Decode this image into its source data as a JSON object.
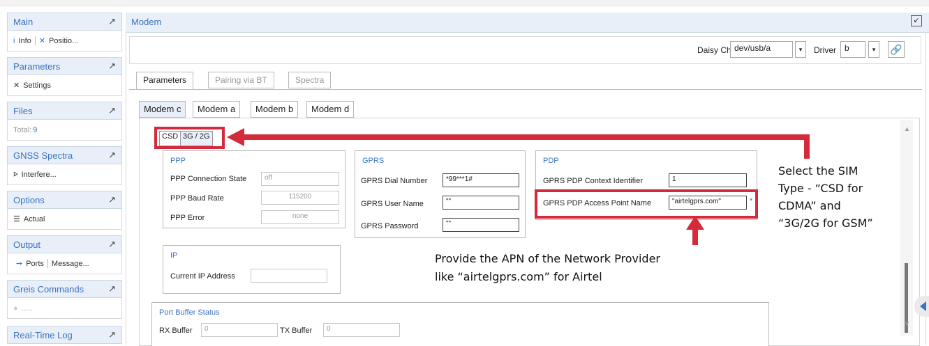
{
  "sidebar": [
    {
      "title": "Main",
      "items": [
        {
          "icon": "i",
          "label": "Info"
        },
        {
          "icon": "✕",
          "label": "Positio..."
        }
      ]
    },
    {
      "title": "Parameters",
      "items": [
        {
          "icon": "✕",
          "label": "Settings"
        }
      ]
    },
    {
      "title": "Files",
      "items": [
        {
          "label": "Total:",
          "count": "9"
        }
      ]
    },
    {
      "title": "GNSS Spectra",
      "items": [
        {
          "icon": "⦠",
          "label": "Interfere..."
        }
      ]
    },
    {
      "title": "Options",
      "items": [
        {
          "icon": "☰",
          "label": "Actual"
        }
      ]
    },
    {
      "title": "Output",
      "items": [
        {
          "icon": "➙",
          "label": "Ports"
        },
        {
          "label": "Message..."
        }
      ]
    },
    {
      "title": "Greis Commands",
      "items": [
        {
          "icon": "●",
          "label": "....."
        }
      ]
    },
    {
      "title": "Real-Time Log",
      "items": []
    }
  ],
  "modem": {
    "title": "Modem",
    "daisy_chain_label": "Daisy Chain",
    "daisy_chain_value": "dev/usb/a",
    "driver_label": "Driver",
    "driver_value": "b"
  },
  "tabs": [
    "Parameters",
    "Pairing via BT",
    "Spectra"
  ],
  "modem_tabs": [
    "Modem c",
    "Modem a",
    "Modem b",
    "Modem d"
  ],
  "sim_tabs": [
    "CSD",
    "3G / 2G"
  ],
  "ppp": {
    "title": "PPP",
    "fields": [
      {
        "label": "PPP Connection State",
        "value": "off"
      },
      {
        "label": "PPP Baud Rate",
        "value": "115200"
      },
      {
        "label": "PPP Error",
        "value": "none"
      }
    ]
  },
  "gprs": {
    "title": "GPRS",
    "fields": [
      {
        "label": "GPRS Dial Number",
        "value": "*99***1#"
      },
      {
        "label": "GPRS User Name",
        "value": "\"\""
      },
      {
        "label": "GPRS Password",
        "value": "\"\""
      }
    ]
  },
  "pdp": {
    "title": "PDP",
    "fields": [
      {
        "label": "GPRS PDP Context Identifier",
        "value": "1"
      },
      {
        "label": "GPRS PDP Access Point Name",
        "value": "\"airtelgprs.com\""
      }
    ]
  },
  "ip": {
    "title": "IP",
    "label": "Current IP Address",
    "value": ""
  },
  "port_buffer": {
    "title": "Port Buffer Status",
    "rx_label": "RX Buffer",
    "rx_value": "0",
    "tx_label": "TX Buffer",
    "tx_value": "0"
  },
  "annotations": {
    "sim_type": [
      "Select the SIM",
      "Type - “CSD for",
      "CDMA” and",
      "“3G/2G for GSM”"
    ],
    "apn": [
      "Provide the APN of the Network Provider",
      "like “airtelgprs.com” for Airtel"
    ]
  },
  "colors": {
    "accent": "#3a73c0",
    "annotation_red": "#d42a3b"
  }
}
